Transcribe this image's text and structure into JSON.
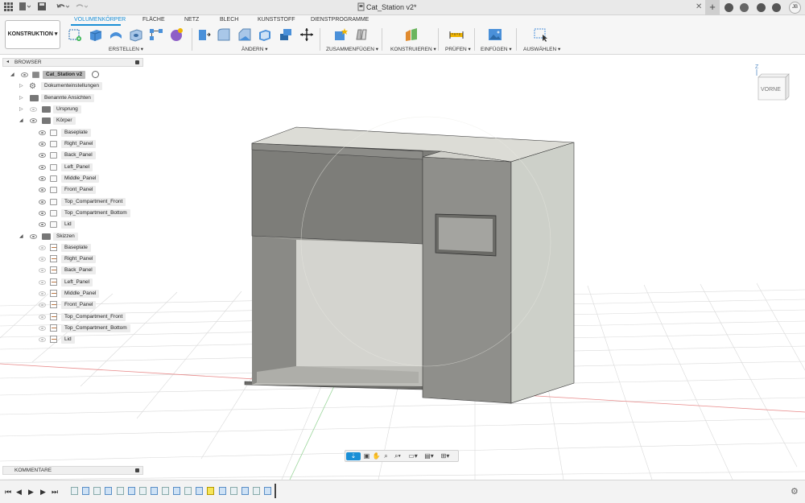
{
  "title_bar": {
    "document_title": "Cat_Station v2*",
    "user_initials": "JB",
    "icons": [
      "grid-icon",
      "file-icon",
      "undo-icon",
      "redo-icon",
      "close-tab-icon",
      "new-tab-icon",
      "extensions-icon",
      "job-status-icon",
      "notifications-icon",
      "help-icon"
    ]
  },
  "workspace": {
    "label": "KONSTRUKTION"
  },
  "tabs": [
    {
      "label": "VOLUMENKÖRPER",
      "active": true
    },
    {
      "label": "FLÄCHE",
      "active": false
    },
    {
      "label": "NETZ",
      "active": false
    },
    {
      "label": "BLECH",
      "active": false
    },
    {
      "label": "KUNSTSTOFF",
      "active": false
    },
    {
      "label": "DIENSTPROGRAMME",
      "active": false
    }
  ],
  "tool_groups": [
    {
      "label": "ERSTELLEN"
    },
    {
      "label": "ÄNDERN"
    },
    {
      "label": "ZUSAMMENFÜGEN"
    },
    {
      "label": "KONSTRUIEREN"
    },
    {
      "label": "PRÜFEN"
    },
    {
      "label": "EINFÜGEN"
    },
    {
      "label": "AUSWÄHLEN"
    }
  ],
  "accent_color": "#1a8fd6",
  "browser": {
    "header": "BROWSER",
    "root": "Cat_Station v2",
    "top_items": [
      "Dokumenteinstellungen",
      "Benannte Ansichten",
      "Ursprung"
    ],
    "bodies_folder": "Körper",
    "bodies": [
      "Baseplate",
      "Right_Panel",
      "Back_Panel",
      "Left_Panel",
      "Middle_Panel",
      "Front_Panel",
      "Top_Compartment_Front",
      "Top_Compartment_Bottom",
      "Lid"
    ],
    "sketches_folder": "Skizzen",
    "sketches": [
      "Baseplate",
      "Right_Panel",
      "Back_Panel",
      "Left_Panel",
      "Middle_Panel",
      "Front_Panel",
      "Top_Compartment_Front",
      "Top_Compartment_Bottom",
      "Lid"
    ]
  },
  "comments": {
    "header": "KOMMENTARE"
  },
  "view_cube": {
    "face_label": "VORNE",
    "axis_label": "Z"
  },
  "timeline": {
    "feature_count": 18
  }
}
